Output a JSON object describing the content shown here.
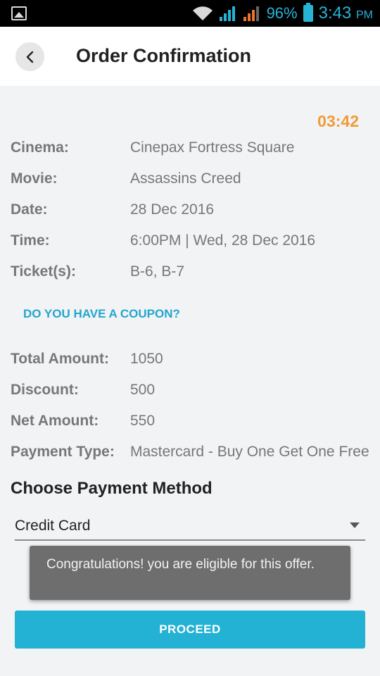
{
  "status_bar": {
    "battery_percent": "96%",
    "time": "3:43",
    "ampm": "PM"
  },
  "header": {
    "title": "Order Confirmation"
  },
  "timer": "03:42",
  "details": [
    {
      "label": "Cinema:",
      "value": "Cinepax Fortress Square"
    },
    {
      "label": "Movie:",
      "value": "Assassins Creed"
    },
    {
      "label": "Date:",
      "value": "28 Dec 2016"
    },
    {
      "label": "Time:",
      "value": "6:00PM | Wed, 28 Dec 2016"
    },
    {
      "label": "Ticket(s):",
      "value": "B-6, B-7"
    }
  ],
  "coupon_link": "DO YOU HAVE A COUPON?",
  "amounts": [
    {
      "label": "Total Amount:",
      "value": "1050"
    },
    {
      "label": "Discount:",
      "value": "500"
    },
    {
      "label": "Net Amount:",
      "value": "550"
    },
    {
      "label": "Payment Type:",
      "value": "Mastercard - Buy One Get One Free"
    }
  ],
  "payment_method": {
    "title": "Choose Payment Method",
    "selected": "Credit Card"
  },
  "toast": "Congratulations! you are eligible for this offer.",
  "proceed_label": "PROCEED",
  "colors": {
    "accent": "#23b1d4",
    "timer": "#f29a38",
    "link": "#23a6cf"
  }
}
